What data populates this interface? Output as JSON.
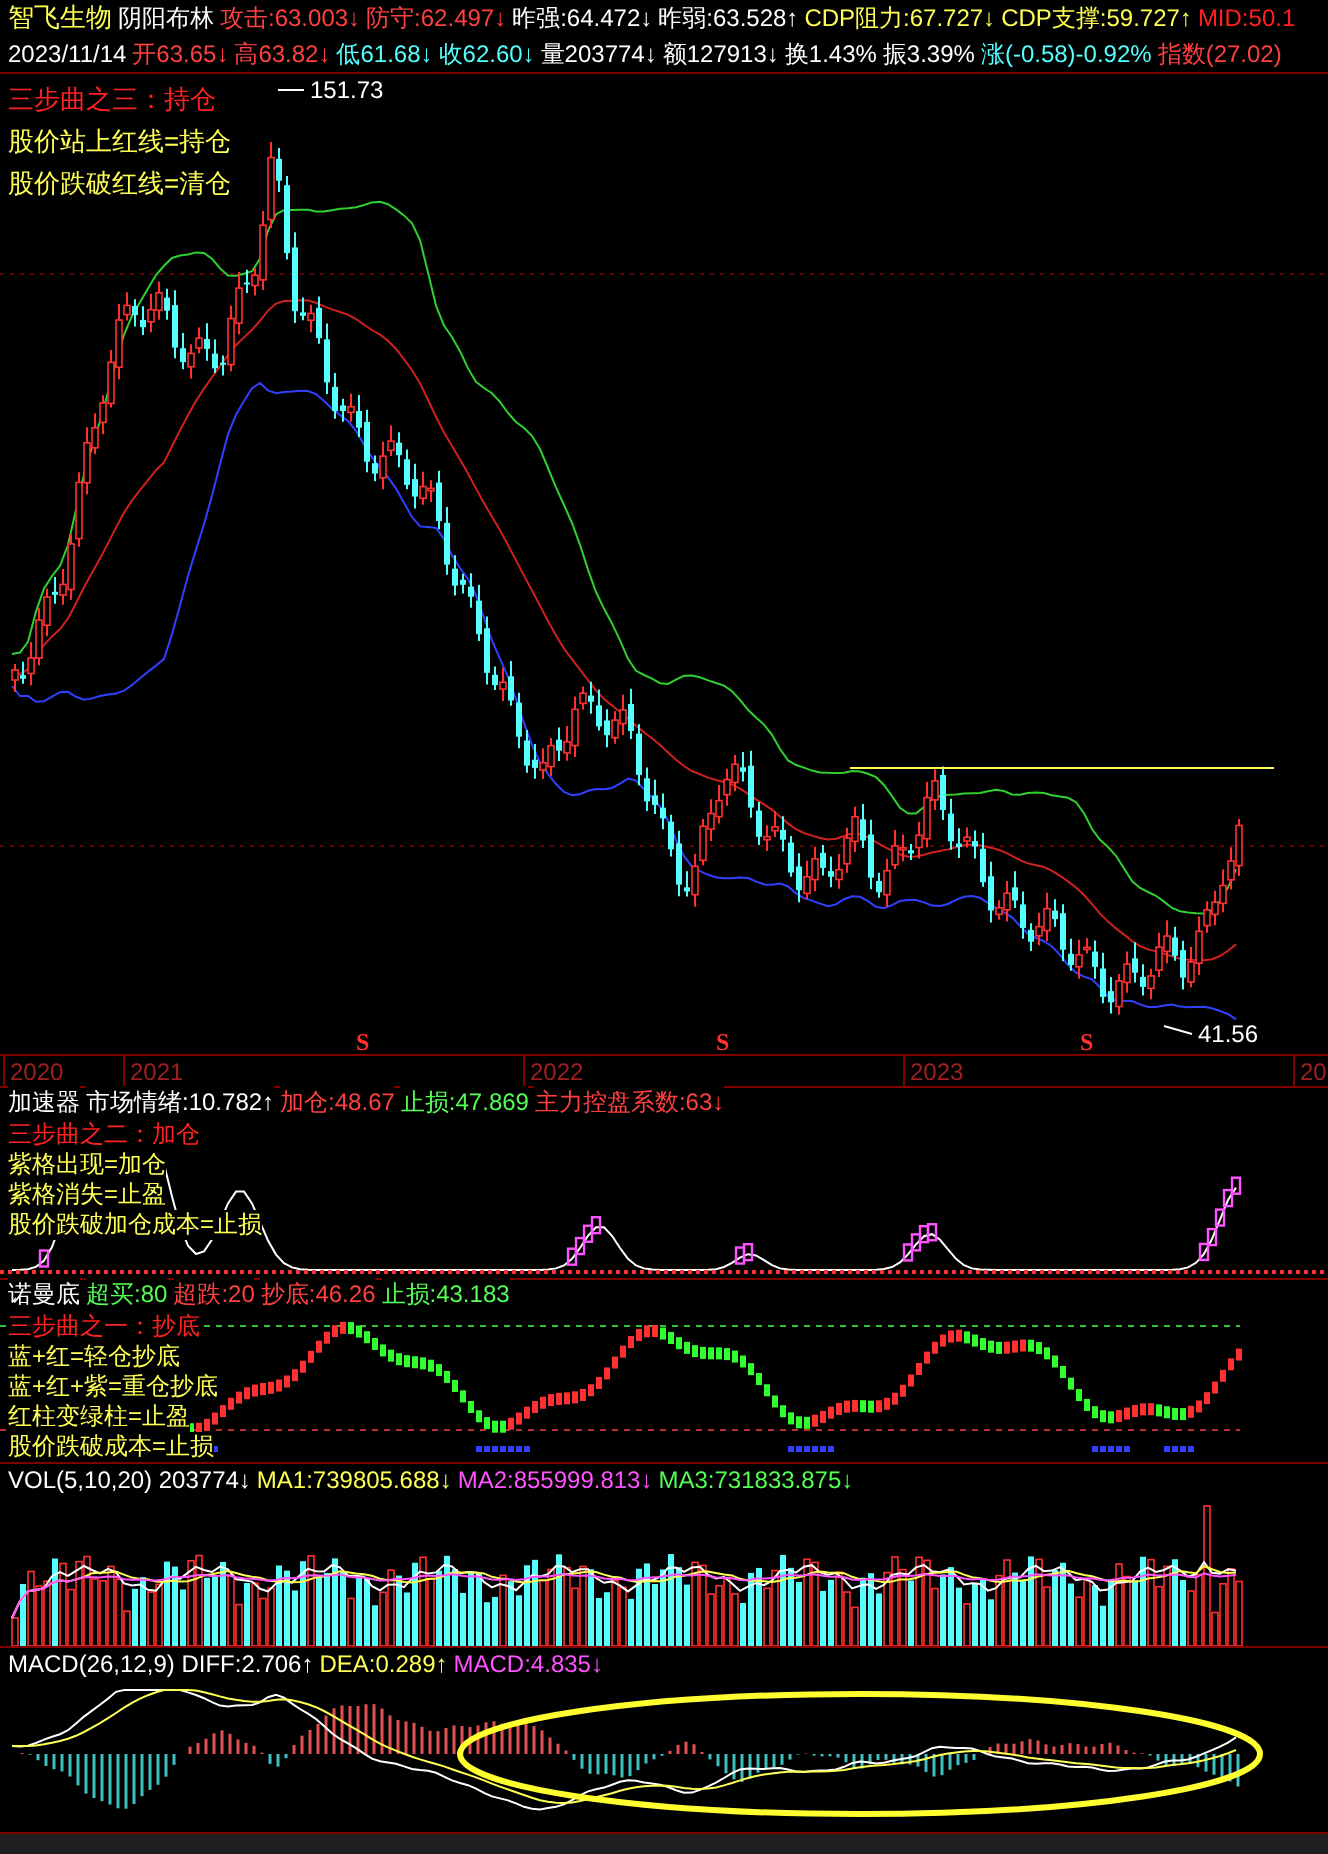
{
  "quote_bar": {
    "stock_name": "智飞生物",
    "indicator": "阴阳布林",
    "items": [
      {
        "text": "攻击:63.003↓",
        "color": "#ff4040"
      },
      {
        "text": "防守:62.497↓",
        "color": "#ff4040"
      },
      {
        "text": "昨强:64.472↓",
        "color": "#ffffff"
      },
      {
        "text": "昨弱:63.528↑",
        "color": "#ffffff"
      },
      {
        "text": "CDP阻力:67.727↓",
        "color": "#ffff54"
      },
      {
        "text": "CDP支撑:59.727↑",
        "color": "#ffff54"
      },
      {
        "text": "MID:50.1",
        "color": "#ff2020"
      }
    ]
  },
  "date_bar": {
    "date": "2023/11/14",
    "items": [
      {
        "text": "开63.65↓",
        "color": "#ff4040"
      },
      {
        "text": "高63.82↓",
        "color": "#ff4040"
      },
      {
        "text": "低61.68↓",
        "color": "#54ffff"
      },
      {
        "text": "收62.60↓",
        "color": "#54ffff"
      },
      {
        "text": "量203774↓",
        "color": "#ffffff"
      },
      {
        "text": "额127913↓",
        "color": "#ffffff"
      },
      {
        "text": "换1.43%",
        "color": "#ffffff"
      },
      {
        "text": "振3.39%",
        "color": "#ffffff"
      },
      {
        "text": "涨(-0.58)-0.92%",
        "color": "#54ffff"
      },
      {
        "text": "指数(27.02)",
        "color": "#ff4040"
      }
    ]
  },
  "price_chart": {
    "notes": [
      {
        "text": "三步曲之三：持仓",
        "color": "#ff2020"
      },
      {
        "text": "股价站上红线=持仓",
        "color": "#ffff54"
      },
      {
        "text": "股价跌破红线=清仓",
        "color": "#ffff54"
      }
    ],
    "high_label": "151.73",
    "low_label": "41.56",
    "signals": [
      "S",
      "S",
      "S"
    ],
    "years": [
      "2020",
      "2021",
      "2022",
      "2023",
      "20"
    ]
  },
  "indicator_panels": [
    {
      "kind": "accelerator",
      "legend": [
        {
          "text": "加速器",
          "color": "#ffffff"
        },
        {
          "text": "市场情绪:10.782↑",
          "color": "#ffffff"
        },
        {
          "text": "加仓:48.67",
          "color": "#ff4040"
        },
        {
          "text": "止损:47.869",
          "color": "#54ff54"
        },
        {
          "text": "主力控盘系数:63↓",
          "color": "#ff4040"
        }
      ],
      "notes": [
        {
          "text": "三步曲之二：加仓",
          "color": "#ff2020"
        },
        {
          "text": "紫格出现=加仓",
          "color": "#ffff54"
        },
        {
          "text": "紫格消失=止盈",
          "color": "#ffff54"
        },
        {
          "text": "股价跌破加仓成本=止损",
          "color": "#ffff54"
        }
      ]
    },
    {
      "kind": "normandy",
      "legend": [
        {
          "text": "诺曼底",
          "color": "#ffffff"
        },
        {
          "text": "超买:80",
          "color": "#54ff54"
        },
        {
          "text": "超跌:20",
          "color": "#ff4040"
        },
        {
          "text": "抄底:46.26",
          "color": "#ff4040"
        },
        {
          "text": "止损:43.183",
          "color": "#54ff54"
        }
      ],
      "notes": [
        {
          "text": "三步曲之一：抄底",
          "color": "#ff2020"
        },
        {
          "text": "蓝+红=轻仓抄底",
          "color": "#ffff54"
        },
        {
          "text": "蓝+红+紫=重仓抄底",
          "color": "#ffff54"
        },
        {
          "text": "红柱变绿柱=止盈",
          "color": "#ffff54"
        },
        {
          "text": "股价跌破成本=止损",
          "color": "#ffff54"
        }
      ]
    },
    {
      "kind": "volume",
      "legend": [
        {
          "text": "VOL(5,10,20) 203774↓",
          "color": "#ffffff"
        },
        {
          "text": "MA1:739805.688↓",
          "color": "#ffff54"
        },
        {
          "text": "MA2:855999.813↓",
          "color": "#ff54ff"
        },
        {
          "text": "MA3:731833.875↓",
          "color": "#54ff54"
        }
      ]
    },
    {
      "kind": "macd",
      "legend": [
        {
          "text": "MACD(26,12,9) DIFF:2.706↑",
          "color": "#ffffff"
        },
        {
          "text": "DEA:0.289↑",
          "color": "#ffff54"
        },
        {
          "text": "MACD:4.835↓",
          "color": "#ff54ff"
        }
      ]
    }
  ]
}
